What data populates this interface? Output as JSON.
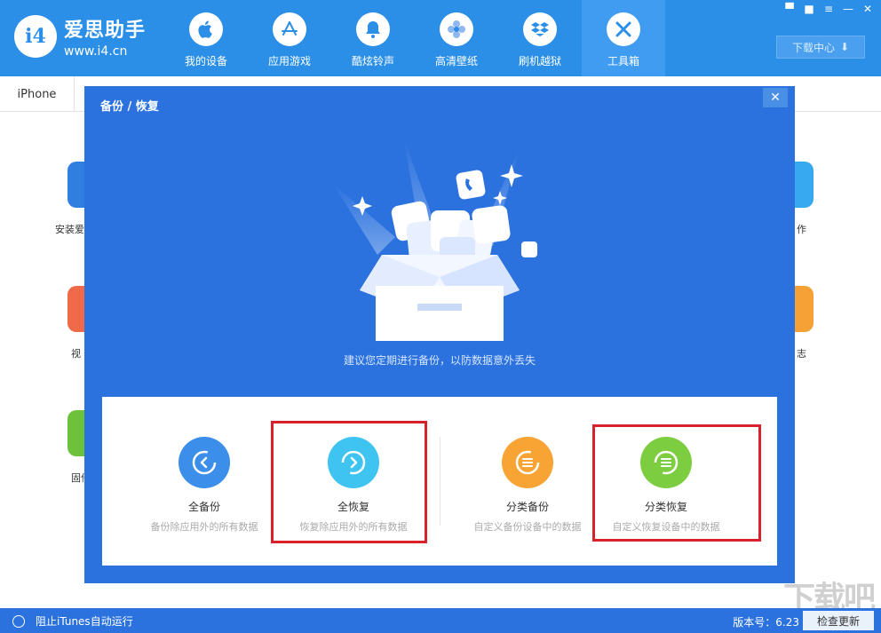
{
  "app": {
    "title": "爱思助手",
    "url": "www.i4.cn",
    "logo_text": "i4"
  },
  "nav": [
    {
      "label": "我的设备",
      "icon": "apple-icon"
    },
    {
      "label": "应用游戏",
      "icon": "app-store-icon"
    },
    {
      "label": "酷炫铃声",
      "icon": "bell-icon"
    },
    {
      "label": "高清壁纸",
      "icon": "flower-icon"
    },
    {
      "label": "刷机越狱",
      "icon": "dropbox-icon"
    },
    {
      "label": "工具箱",
      "icon": "tools-icon",
      "active": true
    }
  ],
  "window_controls": [
    "▀",
    "■",
    "≡",
    "—",
    "✕"
  ],
  "download_center": {
    "label": "下载中心",
    "arrow": "⬇"
  },
  "device_tab": "iPhone",
  "background_labels": [
    "安装爱",
    "视",
    "固件",
    "作",
    "志"
  ],
  "modal": {
    "title": "备份 / 恢复",
    "close": "✕",
    "tip": "建议您定期进行备份，以防数据意外丢失",
    "options": [
      {
        "name": "全备份",
        "desc": "备份除应用外的所有数据",
        "color": "#3b8fea"
      },
      {
        "name": "全恢复",
        "desc": "恢复除应用外的所有数据",
        "color": "#3fc3f0"
      },
      {
        "name": "分类备份",
        "desc": "自定义备份设备中的数据",
        "color": "#f7a435"
      },
      {
        "name": "分类恢复",
        "desc": "自定义恢复设备中的数据",
        "color": "#7ccd3f"
      }
    ]
  },
  "status": {
    "itunes": "阻止iTunes自动运行",
    "version": "版本号：6.23",
    "check_update": "检查更新"
  },
  "watermark": "下载吧",
  "colors": {
    "top_bar": "#2b8fe8",
    "modal_bg": "#2b72df",
    "highlight": "#d8212a"
  }
}
